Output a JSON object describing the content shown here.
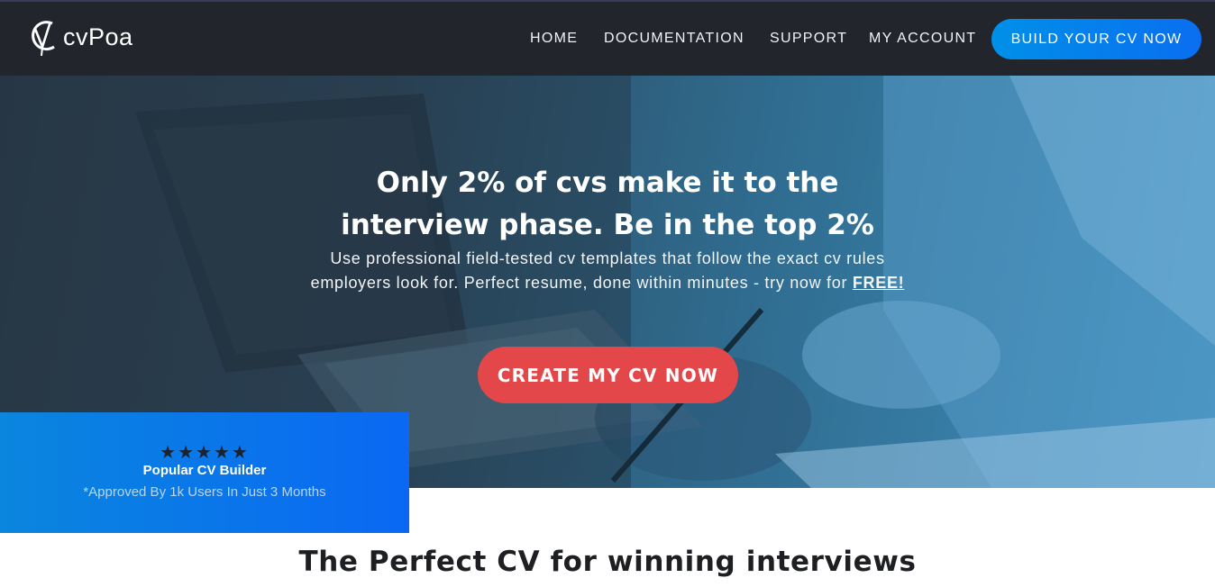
{
  "brand": {
    "name": "cvPoa",
    "logo_icon": "cv-monogram-icon"
  },
  "nav": {
    "items": [
      "HOME",
      "DOCUMENTATION",
      "SUPPORT",
      "MY ACCOUNT"
    ],
    "cta_label": "BUILD YOUR CV NOW"
  },
  "hero": {
    "title": "Only 2% of cvs make it to the interview phase. Be in the top 2%",
    "subtitle": "Use professional field-tested cv templates that follow the exact cv rules employers look for. Perfect resume, done within minutes - try now for",
    "subtitle_emphasis": "FREE!",
    "button_label": "CREATE MY CV NOW"
  },
  "badge": {
    "stars": "★★★★★",
    "rating": 5,
    "title": "Popular CV Builder",
    "note": "*Approved By 1k Users In Just 3 Months"
  },
  "section": {
    "title": "The Perfect CV for winning interviews"
  },
  "colors": {
    "topbar": "#22252b",
    "cta_blue": "#0a6ef0",
    "create_red": "#e4474a",
    "badge_blue": "#0a86de"
  }
}
